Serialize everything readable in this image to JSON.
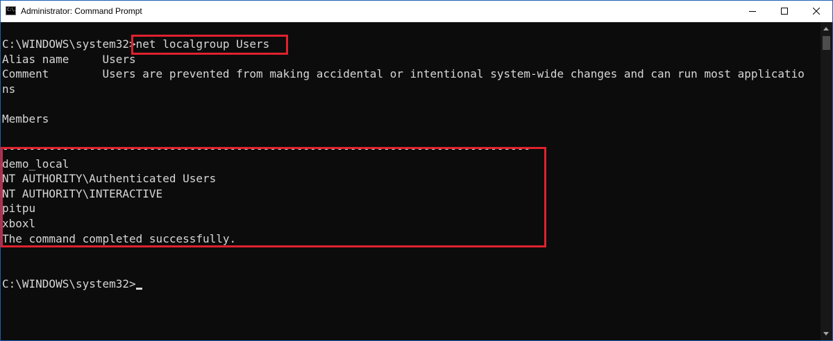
{
  "window": {
    "title": "Administrator: Command Prompt",
    "icon": "cmd-icon",
    "icon_glyph": "C:\\."
  },
  "controls": {
    "minimize": "minimize-icon",
    "maximize": "maximize-icon",
    "close": "close-icon"
  },
  "console": {
    "lines": [
      "",
      "C:\\WINDOWS\\system32>net localgroup Users",
      "Alias name     Users",
      "Comment        Users are prevented from making accidental or intentional system-wide changes and can run most applicatio",
      "ns",
      "",
      "Members",
      "",
      "-------------------------------------------------------------------------------",
      "demo_local",
      "NT AUTHORITY\\Authenticated Users",
      "NT AUTHORITY\\INTERACTIVE",
      "pitpu",
      "xboxl",
      "The command completed successfully.",
      "",
      "",
      "C:\\WINDOWS\\system32>"
    ]
  },
  "colors": {
    "background": "#0c0c0c",
    "text": "#d7d7d7",
    "highlight": "#e0212e",
    "window_border": "#1a5fb4"
  }
}
